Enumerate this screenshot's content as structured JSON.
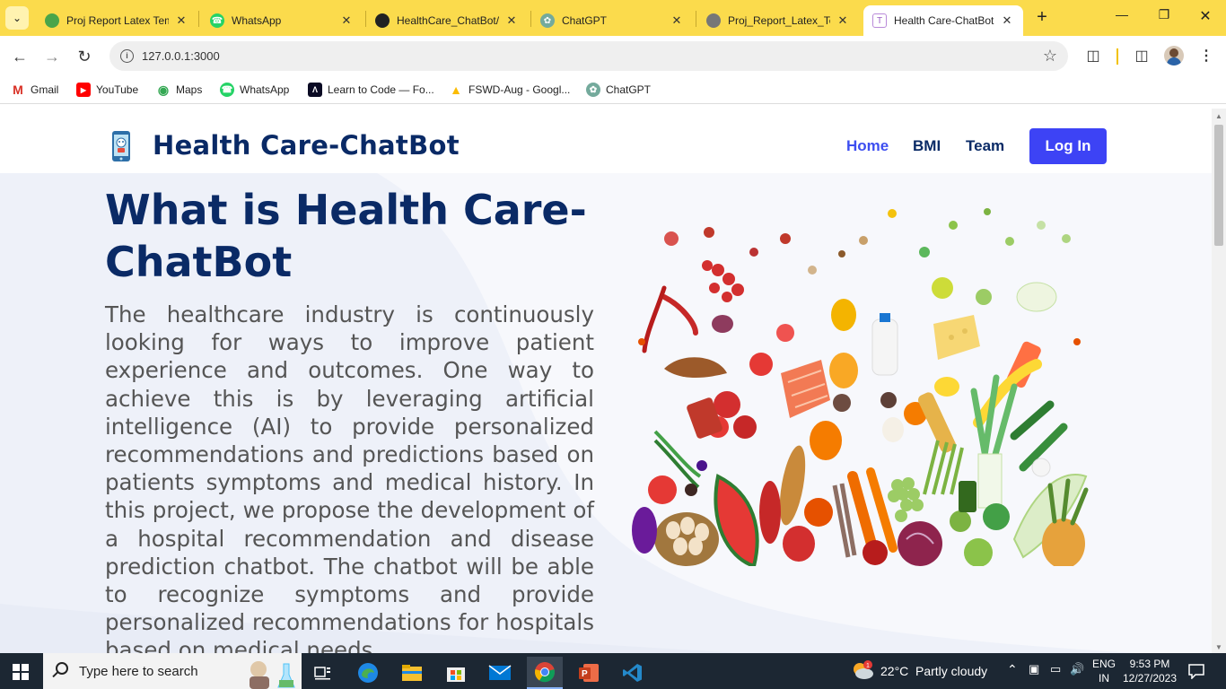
{
  "browser": {
    "tabs": [
      {
        "title": "Proj Report Latex Tem",
        "icon": "overleaf-icon"
      },
      {
        "title": "WhatsApp",
        "icon": "whatsapp-icon"
      },
      {
        "title": "HealthCare_ChatBot/",
        "icon": "github-icon"
      },
      {
        "title": "ChatGPT",
        "icon": "chatgpt-icon"
      },
      {
        "title": "Proj_Report_Latex_Te",
        "icon": "globe-icon"
      },
      {
        "title": "Health Care-ChatBot",
        "icon": "page-icon",
        "active": true
      }
    ],
    "address": "127.0.0.1:3000",
    "bookmarks": [
      {
        "label": "Gmail",
        "icon": "gmail-icon"
      },
      {
        "label": "YouTube",
        "icon": "youtube-icon"
      },
      {
        "label": "Maps",
        "icon": "maps-icon"
      },
      {
        "label": "WhatsApp",
        "icon": "whatsapp-icon"
      },
      {
        "label": "Learn to Code — Fo...",
        "icon": "freecodecamp-icon"
      },
      {
        "label": "FSWD-Aug - Googl...",
        "icon": "drive-icon"
      },
      {
        "label": "ChatGPT",
        "icon": "chatgpt-icon"
      }
    ]
  },
  "page": {
    "brand": "Health Care-ChatBot",
    "nav": {
      "home": "Home",
      "bmi": "BMI",
      "team": "Team",
      "login": "Log In"
    },
    "hero_title": "What is Health Care-ChatBot",
    "hero_text": "The healthcare industry is continuously looking for ways to improve patient experience and outcomes. One way to achieve this is by leveraging artificial intelligence (AI) to provide personalized recommendations and predictions based on patients symptoms and medical history. In this project, we propose the development of a hospital recommendation and disease prediction chatbot. The chatbot will be able to recognize symptoms and provide personalized recommendations for hospitals based on medical needs.",
    "colors": {
      "brand": "#0a2a66",
      "accent": "#3d43f5",
      "text": "#555555"
    }
  },
  "taskbar": {
    "search_placeholder": "Type here to search",
    "weather": {
      "temp": "22°C",
      "condition": "Partly cloudy"
    },
    "language": {
      "line1": "ENG",
      "line2": "IN"
    },
    "clock": {
      "time": "9:53 PM",
      "date": "12/27/2023"
    }
  }
}
